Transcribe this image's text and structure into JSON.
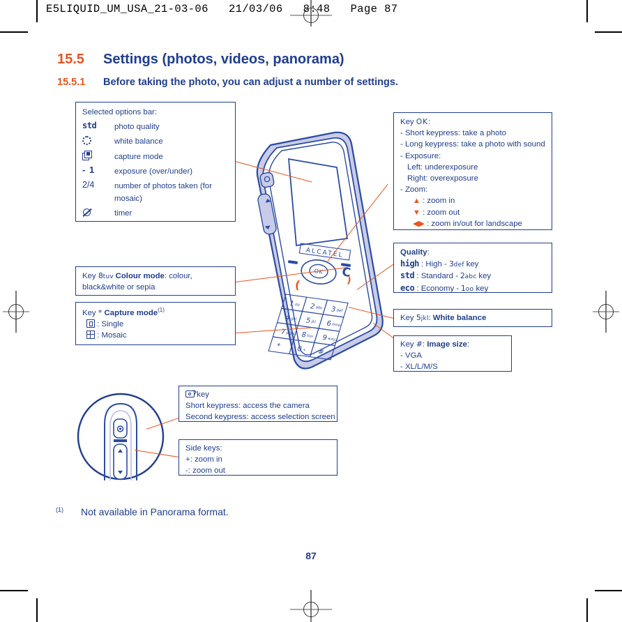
{
  "header": {
    "file_line": "E5LIQUID_UM_USA_21-03-06   21/03/06   8:48   Page 87"
  },
  "headings": {
    "section_number": "15.5",
    "section_title": "Settings (photos, videos, panorama)",
    "sub_number": "15.5.1",
    "sub_title": "Before taking the photo, you can adjust a number of settings."
  },
  "options_box": {
    "title": "Selected options bar:",
    "rows": [
      {
        "icon": "std-quality-icon",
        "glyph": "std",
        "label": "photo quality"
      },
      {
        "icon": "white-balance-icon",
        "glyph": "",
        "label": "white balance"
      },
      {
        "icon": "capture-mode-icon",
        "glyph": "",
        "label": "capture mode"
      },
      {
        "icon": "exposure-icon",
        "glyph": "- 1",
        "label": "exposure (over/under)"
      },
      {
        "icon": "photo-count-icon",
        "glyph": "2/4",
        "label": "number of photos taken (for"
      },
      {
        "icon": "timer-icon",
        "glyph": "",
        "label": "timer"
      }
    ],
    "row5_continuation": "mosaic)"
  },
  "ok_box": {
    "key_label": "Key",
    "key_glyph": "OK",
    "colon": ":",
    "lines": [
      "- Short keypress: take a photo",
      "- Long keypress: take a photo with sound",
      "- Exposure:",
      "Left: underexposure",
      "Right: overexposure",
      "- Zoom:"
    ],
    "zoom_items": [
      {
        "arrow": "up-arrow-icon",
        "text": ": zoom in"
      },
      {
        "arrow": "down-arrow-icon",
        "text": ": zoom out"
      },
      {
        "arrow": "left-right-arrow-icon",
        "text": ": zoom in/out for landscape"
      }
    ]
  },
  "quality_box": {
    "title": "Quality",
    "colon": ":",
    "rows": [
      {
        "glyph": "high",
        "text": ": High -",
        "key_num": "3",
        "key_letters": "def",
        "key_word": "key"
      },
      {
        "glyph": "std",
        "text": ": Standard -",
        "key_num": "2",
        "key_letters": "abc",
        "key_word": "key"
      },
      {
        "glyph": "eco",
        "text": ": Economy -",
        "key_num": "1",
        "key_letters": "oo",
        "key_word": "key"
      }
    ]
  },
  "white_balance_box": {
    "key_label": "Key",
    "key_num": "5",
    "key_letters": "jkl",
    "colon": ":",
    "title": "White balance"
  },
  "image_size_box": {
    "key_label": "Key",
    "key_glyph": "#",
    "colon": ":",
    "title": "Image size",
    "title_colon": ":",
    "lines": [
      "- VGA",
      "- XL/L/M/S"
    ]
  },
  "colour_mode_box": {
    "key_label": "Key",
    "key_num": "8",
    "key_letters": "tuv",
    "title": "Colour mode",
    "text_line1": ": colour,",
    "text_line2": "black&white or sepia"
  },
  "capture_mode_box": {
    "key_label": "Key",
    "key_glyph": "*",
    "title": "Capture mode",
    "footnote_ref": "(1)",
    "rows": [
      {
        "icon": "single-frame-icon",
        "label": ": Single"
      },
      {
        "icon": "mosaic-grid-icon",
        "label": ": Mosaic"
      }
    ]
  },
  "camera_key_box": {
    "icon": "camera-icon",
    "key_word": "key",
    "lines": [
      "Short keypress: access the camera",
      "Second keypress: access selection screen"
    ]
  },
  "side_keys_box": {
    "title": "Side keys:",
    "lines": [
      "+: zoom in",
      "-: zoom out"
    ]
  },
  "phone": {
    "brand": "ALCATEL",
    "ok_key": "OK",
    "clear_key": "C",
    "keys": [
      {
        "num": "1",
        "letters": "oo"
      },
      {
        "num": "2",
        "letters": "abc"
      },
      {
        "num": "3",
        "letters": "def"
      },
      {
        "num": "4",
        "letters": "ghi"
      },
      {
        "num": "5",
        "letters": "jkl"
      },
      {
        "num": "6",
        "letters": "mno"
      },
      {
        "num": "7",
        "letters": "pqrs"
      },
      {
        "num": "8",
        "letters": "tuv"
      },
      {
        "num": "9",
        "letters": "wxyz"
      },
      {
        "num": "*",
        "letters": ""
      },
      {
        "num": "0",
        "letters": "+"
      },
      {
        "num": "#",
        "letters": ""
      }
    ]
  },
  "footnote": {
    "marker": "(1)",
    "text": "Not available in Panorama format."
  },
  "folio": "87",
  "colors": {
    "navy": "#1F3E8C",
    "orange": "#E8541E",
    "phone_fill": "#C9CCE8",
    "phone_line": "#2B4BA0"
  }
}
